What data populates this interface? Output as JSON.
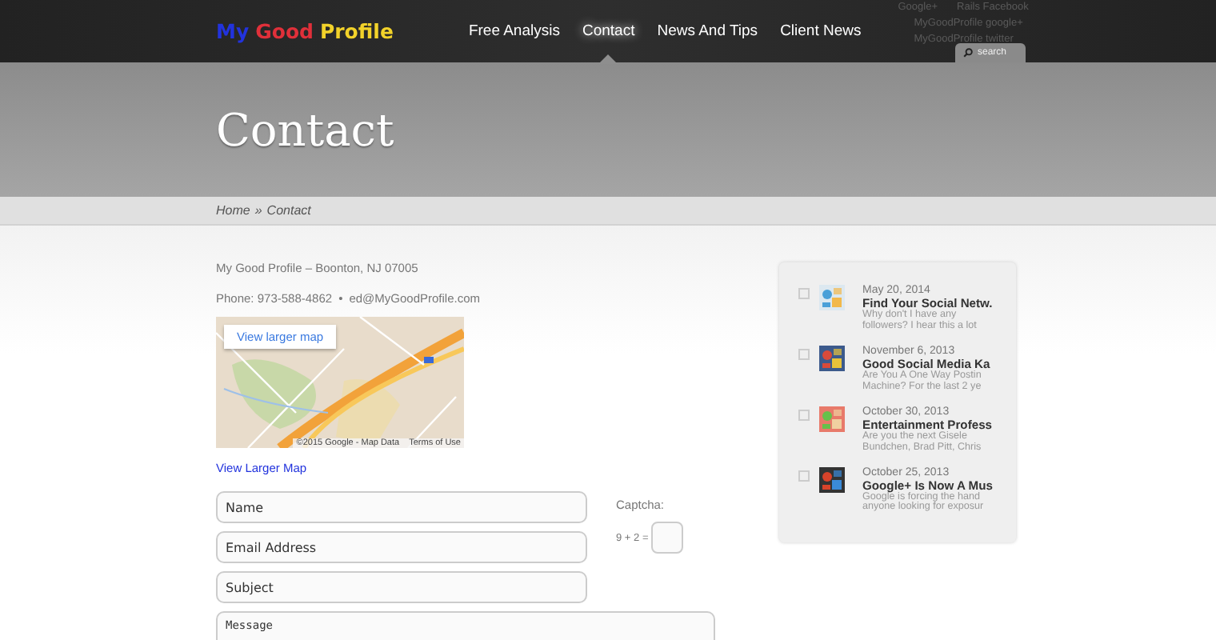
{
  "logo": [
    {
      "text": "My",
      "color": "#2233dd"
    },
    {
      "text": "Good",
      "color": "#e0303a"
    },
    {
      "text": "Profile",
      "color": "#f2d22a"
    }
  ],
  "nav": [
    {
      "label": "Free Analysis",
      "selected": false
    },
    {
      "label": "Contact",
      "selected": true
    },
    {
      "label": "News And Tips",
      "selected": false
    },
    {
      "label": "Client News",
      "selected": false
    }
  ],
  "social_links": [
    [
      "Google+",
      "Rails Facebook"
    ],
    [
      "MyGoodProfile google+"
    ],
    [
      "MyGoodProfile twitter"
    ]
  ],
  "search": {
    "placeholder": "search"
  },
  "page_title": "Contact",
  "breadcrumb": {
    "home": "Home",
    "separator": "»",
    "current": "Contact"
  },
  "address": "My Good Profile – Boonton, NJ 07005",
  "phone": "Phone: 973-588-4862",
  "bullet": "•",
  "email": "ed@MyGoodProfile.com",
  "map": {
    "button": "View larger map",
    "attribution": "©2015 Google - Map Data",
    "terms": "Terms of Use"
  },
  "map_link": "View Larger Map",
  "form": {
    "fields": [
      {
        "placeholder": "Name"
      },
      {
        "placeholder": "Email Address"
      },
      {
        "placeholder": "Subject"
      }
    ],
    "message_placeholder": "Message",
    "captcha_label": "Captcha:",
    "captcha_question": "9 + 2 ="
  },
  "posts": [
    {
      "date": "May 20, 2014",
      "title": "Find Your Social Netw.",
      "lines": [
        "Why don't I have any",
        "followers? I hear this a lot"
      ]
    },
    {
      "date": "November 6, 2013",
      "title": "Good Social Media Ka",
      "lines": [
        "Are You A One Way Postin",
        "Machine? For the last 2 ye"
      ]
    },
    {
      "date": "October 30, 2013",
      "title": "Entertainment Profess",
      "lines": [
        "Are you the next Gisele",
        "Bundchen, Brad Pitt, Chris"
      ]
    },
    {
      "date": "October 25, 2013",
      "title": "Google+ Is Now A Mus",
      "lines": [
        "Google is forcing the hand",
        "anyone looking for exposur"
      ]
    }
  ]
}
